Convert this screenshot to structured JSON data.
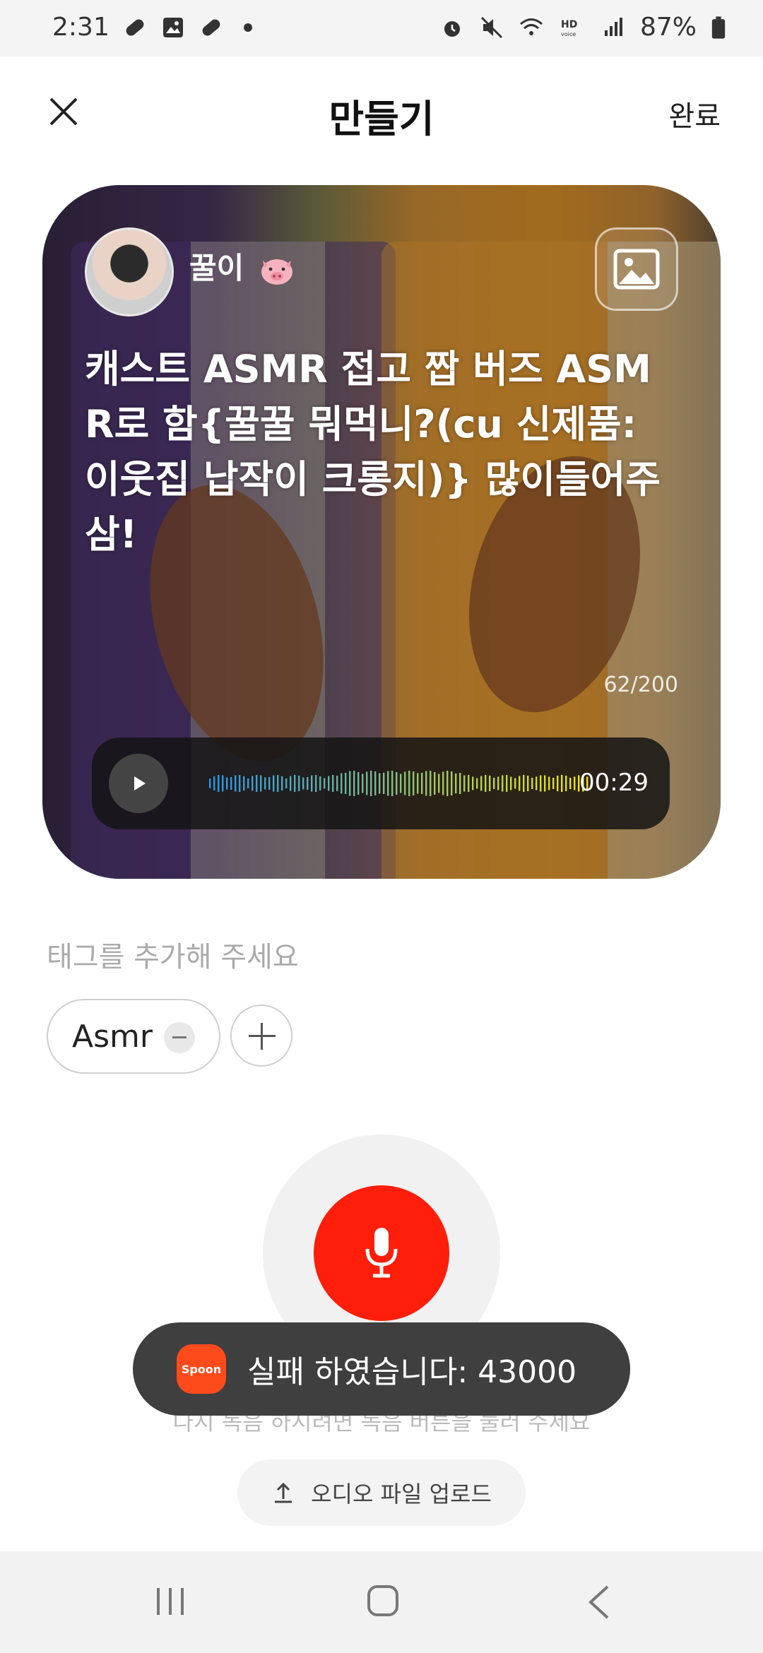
{
  "status_bar": {
    "time": "2:31",
    "battery": "87%"
  },
  "header": {
    "title": "만들기",
    "done_label": "완료"
  },
  "card": {
    "username": "꿀이",
    "cast_text": "캐스트 ASMR 접고 짭 버즈 ASMR로 함{꿀꿀 뭐먹니?(cu 신제품:이웃집 납작이 크롱지)} 많이들어주삼!",
    "char_count": "62/200",
    "duration": "00:29"
  },
  "tags": {
    "label": "태그를 추가해 주세요",
    "items": [
      "Asmr"
    ]
  },
  "hint": "다시 녹음 하시려면 녹음 버튼을 눌러 주세요",
  "toast": {
    "logo_text": "Spoon",
    "message": "실패 하였습니다: 43000"
  },
  "upload": {
    "label": "오디오 파일 업로드"
  },
  "colors": {
    "record": "#ff1e0a",
    "toast_bg": "#3f3f3f",
    "spoon": "#ff4a1c"
  }
}
